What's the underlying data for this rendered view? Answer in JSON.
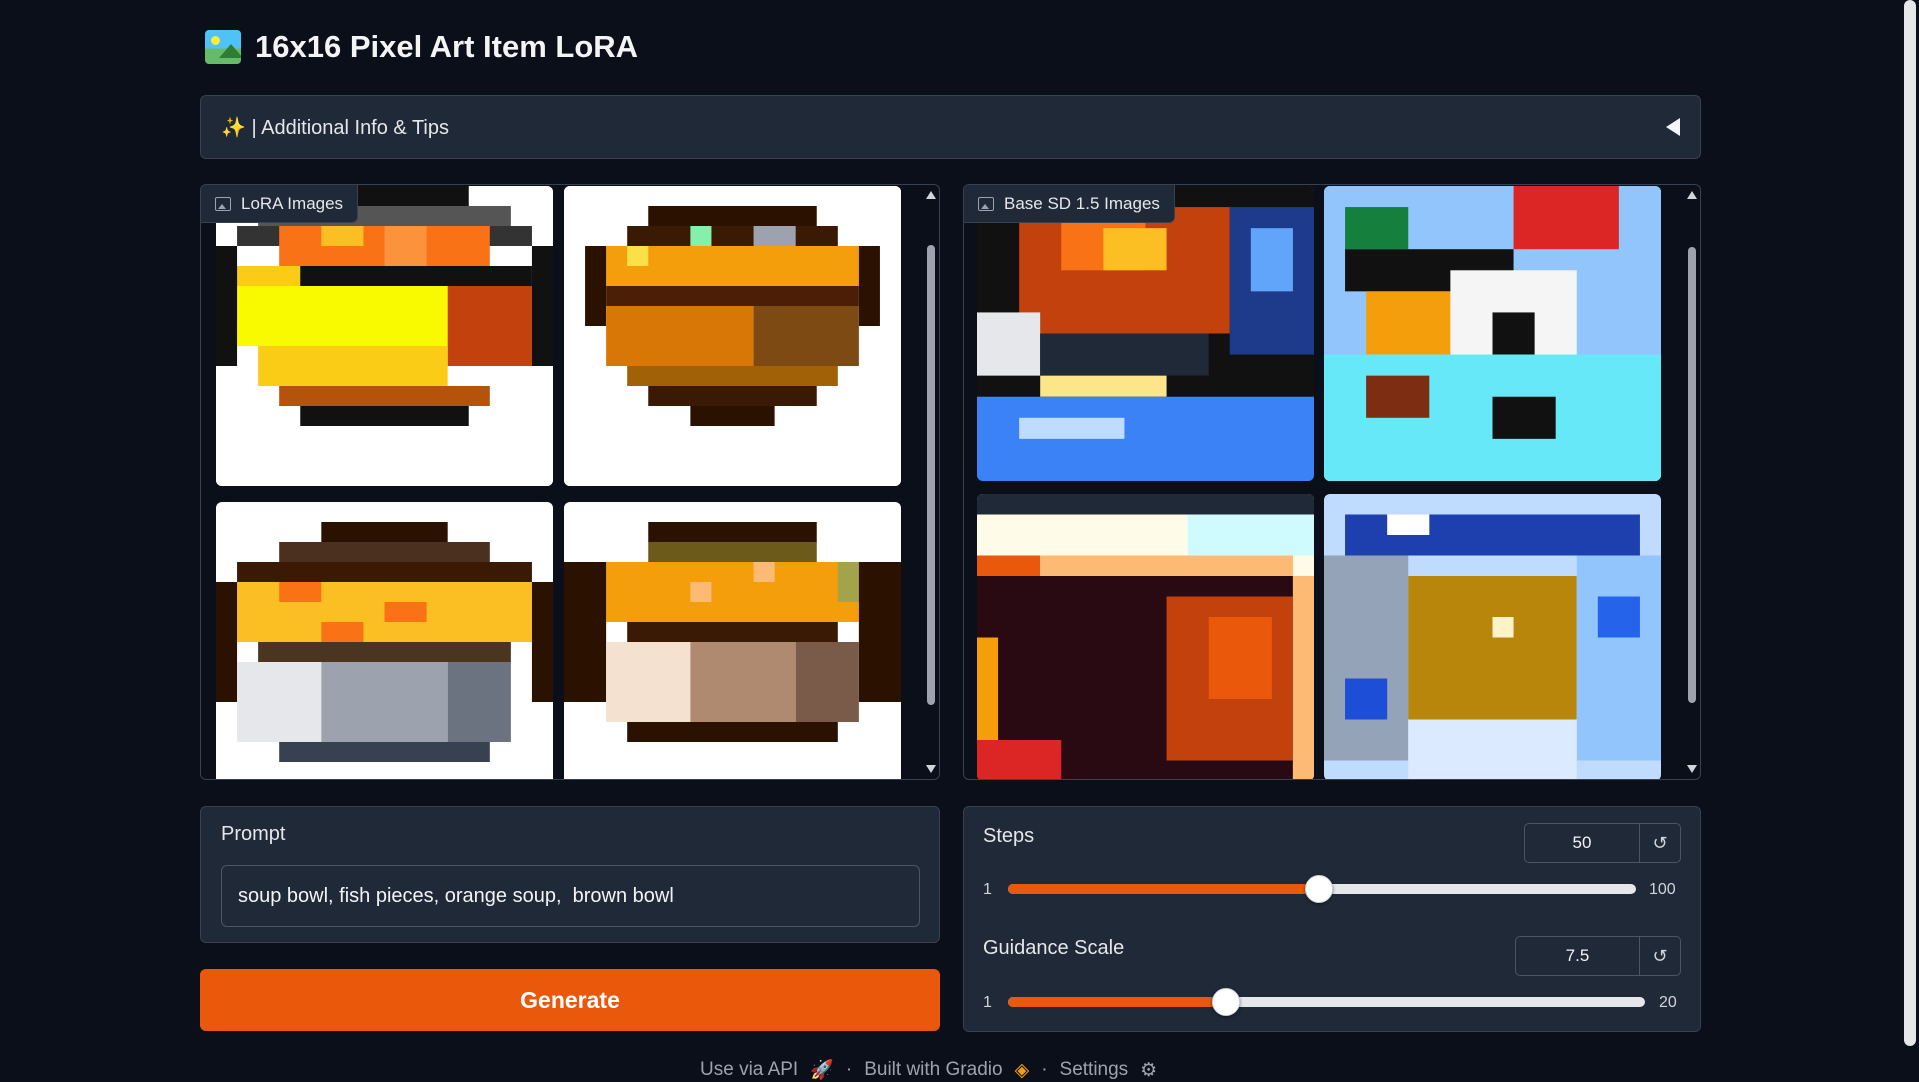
{
  "app": {
    "title": "16x16 Pixel Art Item LoRA",
    "title_icon": "framed-picture-icon"
  },
  "accordion": {
    "label": "✨ | Additional Info & Tips",
    "sparkle_icon": "sparkles-icon",
    "state": "collapsed"
  },
  "galleries": {
    "lora": {
      "label": "LoRA Images",
      "image_count": 4
    },
    "base": {
      "label": "Base SD 1.5 Images",
      "image_count": 4
    }
  },
  "prompt": {
    "label": "Prompt",
    "value": "soup bowl, fish pieces, orange soup,  brown bowl"
  },
  "generate": {
    "label": "Generate"
  },
  "sliders": {
    "steps": {
      "label": "Steps",
      "value": "50",
      "min": "1",
      "max": "100",
      "current": 50
    },
    "guidance": {
      "label": "Guidance Scale",
      "value": "7.5",
      "min": "1",
      "max": "20",
      "current": 7.5
    }
  },
  "footer": {
    "api": "Use via API",
    "built": "Built with Gradio",
    "settings": "Settings",
    "separator": "·"
  },
  "colors": {
    "background": "#0b0f19",
    "panel": "#1f2937",
    "accent": "#ea580c"
  }
}
